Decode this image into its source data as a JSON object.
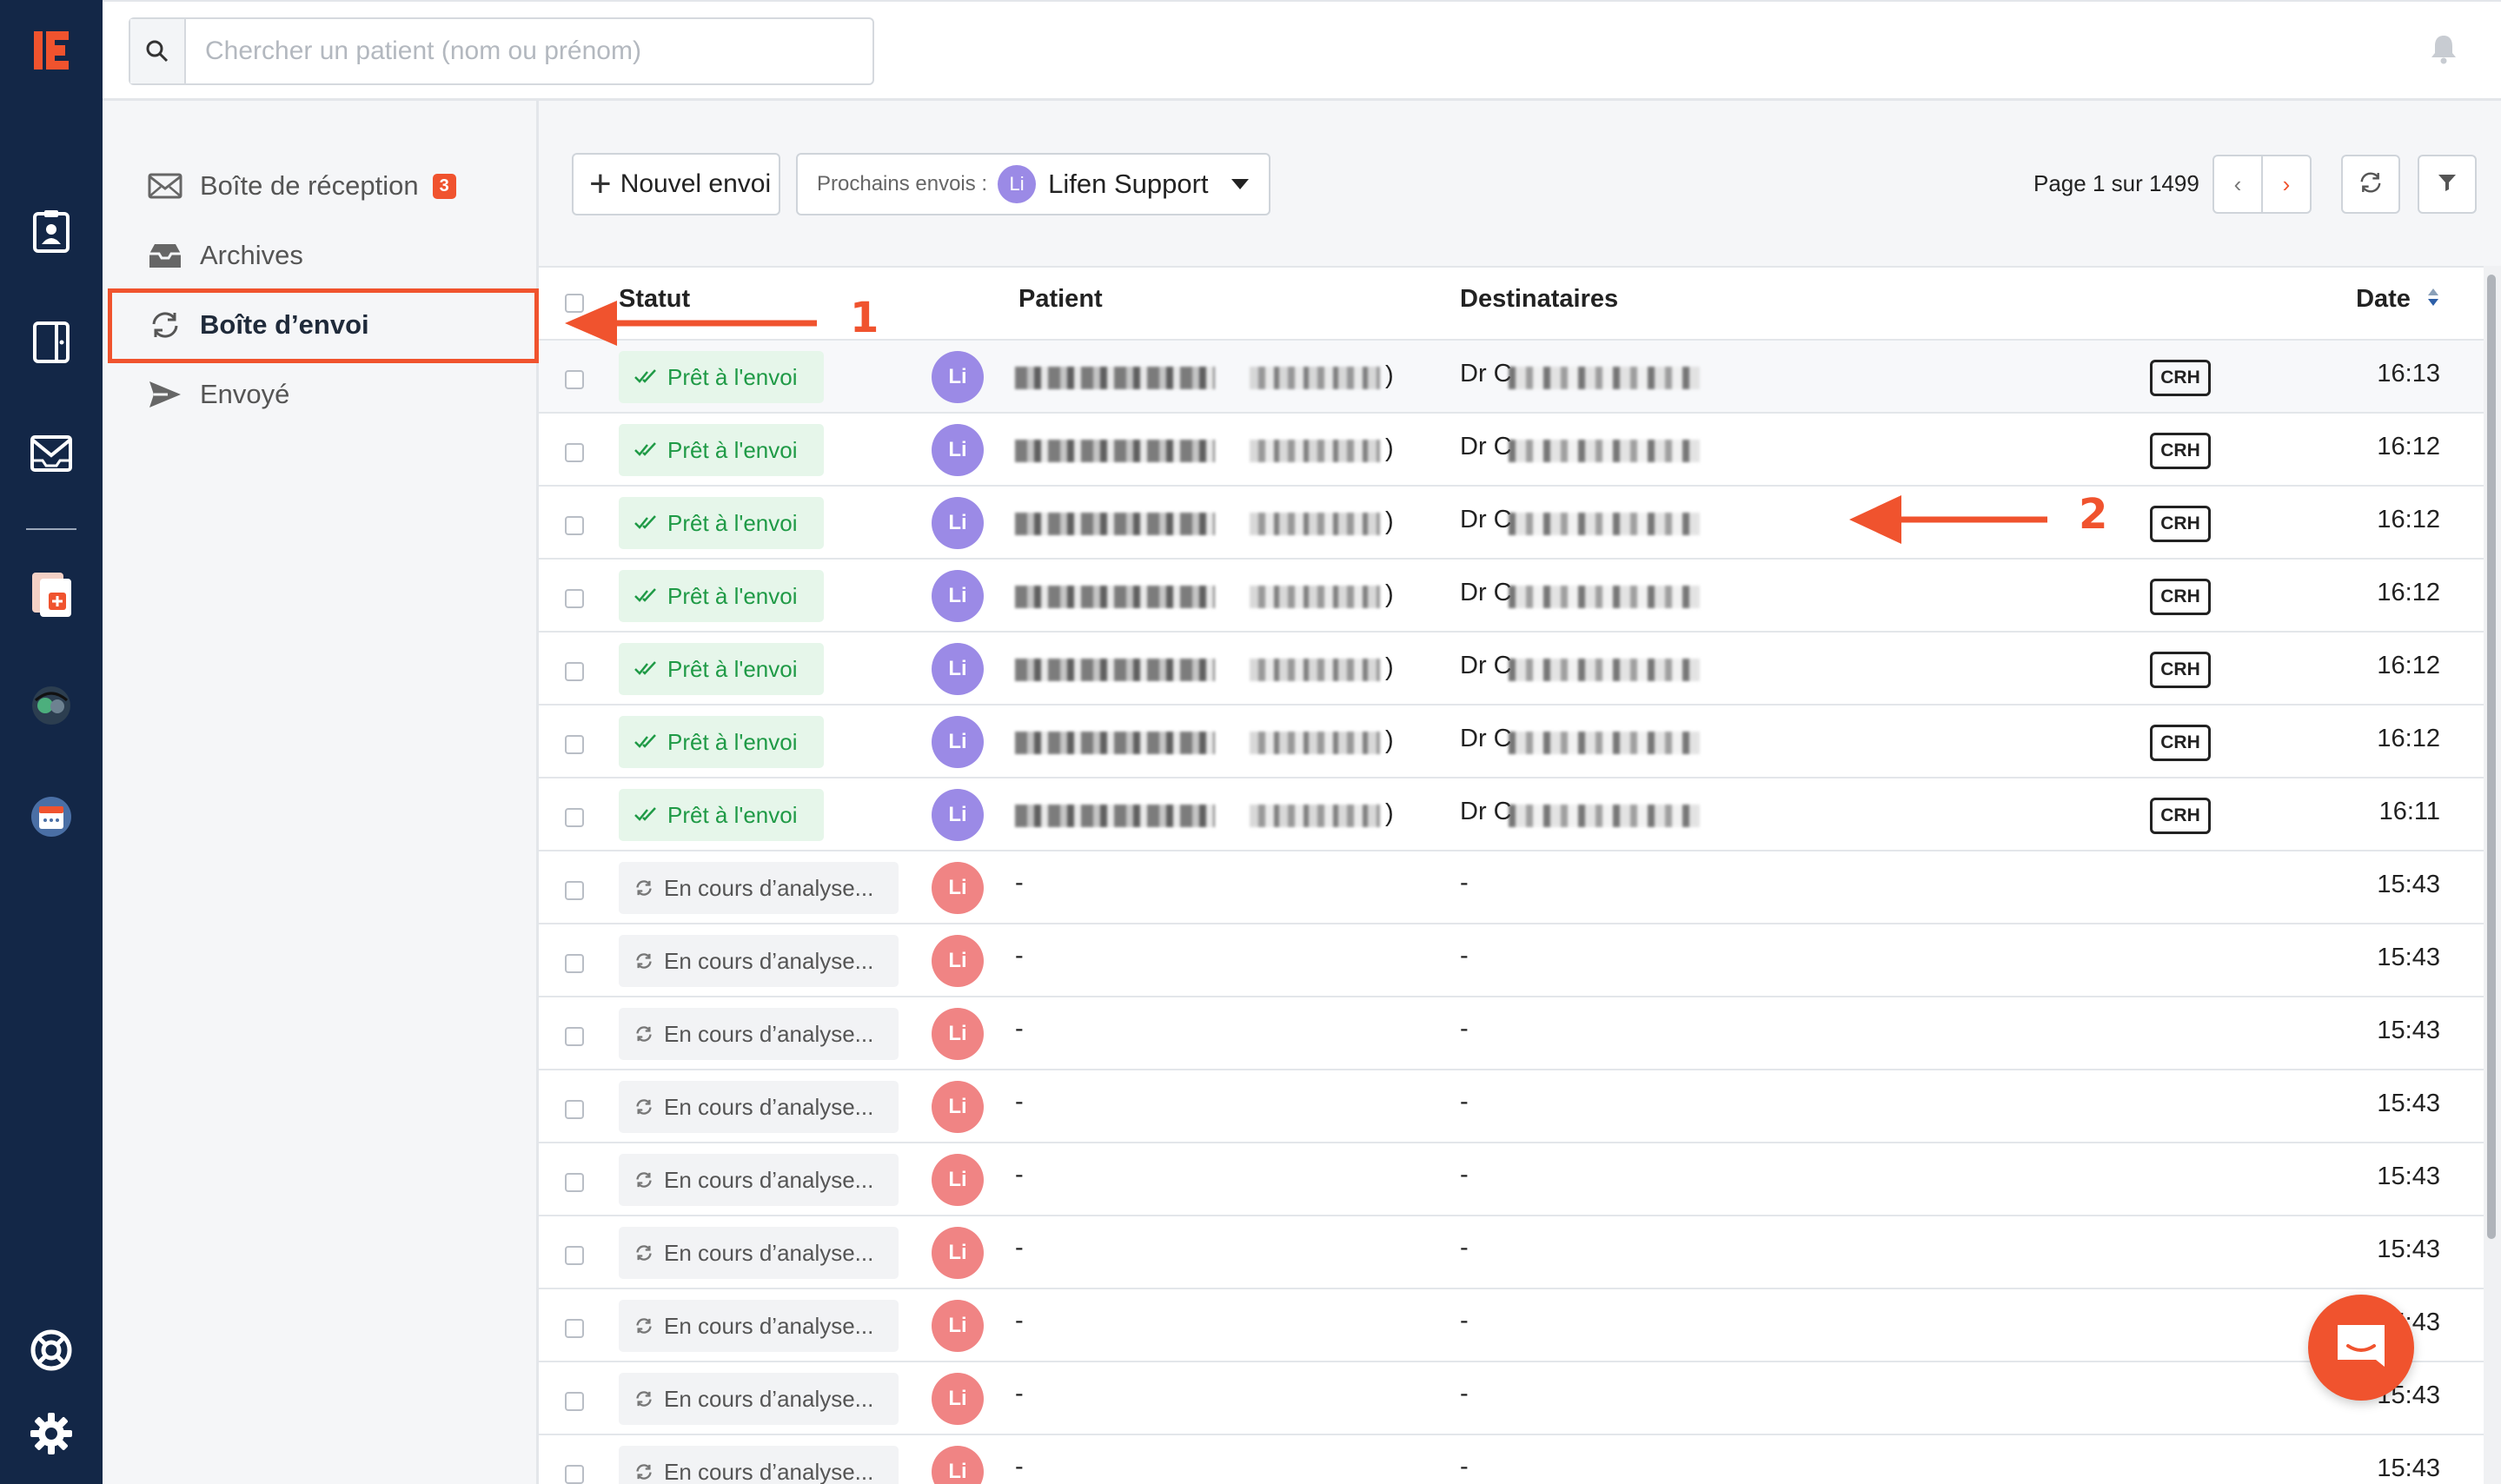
{
  "search": {
    "placeholder": "Chercher un patient (nom ou prénom)"
  },
  "folders": [
    {
      "label": "Boîte de réception",
      "badge": "3",
      "icon": "inbox-icon"
    },
    {
      "label": "Archives",
      "icon": "archive-icon"
    },
    {
      "label": "Boîte d’envoi",
      "icon": "sync-icon",
      "active": true
    },
    {
      "label": "Envoyé",
      "icon": "send-icon"
    }
  ],
  "toolbar": {
    "new_send": "Nouvel envoi",
    "next_sends_label": "Prochains envois :",
    "next_sends_avatar": "Li",
    "next_sends_value": "Lifen Support",
    "page_info": "Page 1 sur 1499",
    "prev": "‹",
    "next": "›"
  },
  "table": {
    "headers": {
      "status": "Statut",
      "patient": "Patient",
      "recipients": "Destinataires",
      "date": "Date"
    },
    "rows": [
      {
        "status": "Prêt à l'envoi",
        "kind": "ready",
        "avatar": "Li",
        "patient_suffix": ")",
        "recipient_prefix": "Dr C",
        "doc": "CRH",
        "time": "16:13"
      },
      {
        "status": "Prêt à l'envoi",
        "kind": "ready",
        "avatar": "Li",
        "patient_suffix": ")",
        "recipient_prefix": "Dr C",
        "doc": "CRH",
        "time": "16:12"
      },
      {
        "status": "Prêt à l'envoi",
        "kind": "ready",
        "avatar": "Li",
        "patient_suffix": ")",
        "recipient_prefix": "Dr C",
        "doc": "CRH",
        "time": "16:12"
      },
      {
        "status": "Prêt à l'envoi",
        "kind": "ready",
        "avatar": "Li",
        "patient_suffix": ")",
        "recipient_prefix": "Dr C",
        "doc": "CRH",
        "time": "16:12"
      },
      {
        "status": "Prêt à l'envoi",
        "kind": "ready",
        "avatar": "Li",
        "patient_suffix": ")",
        "recipient_prefix": "Dr C",
        "doc": "CRH",
        "time": "16:12"
      },
      {
        "status": "Prêt à l'envoi",
        "kind": "ready",
        "avatar": "Li",
        "patient_suffix": ")",
        "recipient_prefix": "Dr C",
        "doc": "CRH",
        "time": "16:12"
      },
      {
        "status": "Prêt à l'envoi",
        "kind": "ready",
        "avatar": "Li",
        "patient_suffix": ")",
        "recipient_prefix": "Dr C",
        "doc": "CRH",
        "time": "16:11"
      },
      {
        "status": "En cours d’analyse...",
        "kind": "analysing",
        "avatar": "Li",
        "patient": "-",
        "recipient": "-",
        "time": "15:43"
      },
      {
        "status": "En cours d’analyse...",
        "kind": "analysing",
        "avatar": "Li",
        "patient": "-",
        "recipient": "-",
        "time": "15:43"
      },
      {
        "status": "En cours d’analyse...",
        "kind": "analysing",
        "avatar": "Li",
        "patient": "-",
        "recipient": "-",
        "time": "15:43"
      },
      {
        "status": "En cours d’analyse...",
        "kind": "analysing",
        "avatar": "Li",
        "patient": "-",
        "recipient": "-",
        "time": "15:43"
      },
      {
        "status": "En cours d’analyse...",
        "kind": "analysing",
        "avatar": "Li",
        "patient": "-",
        "recipient": "-",
        "time": "15:43"
      },
      {
        "status": "En cours d’analyse...",
        "kind": "analysing",
        "avatar": "Li",
        "patient": "-",
        "recipient": "-",
        "time": "15:43"
      },
      {
        "status": "En cours d’analyse...",
        "kind": "analysing",
        "avatar": "Li",
        "patient": "-",
        "recipient": "-",
        "time": "15:43"
      },
      {
        "status": "En cours d’analyse...",
        "kind": "analysing",
        "avatar": "Li",
        "patient": "-",
        "recipient": "-",
        "time": "15:43"
      },
      {
        "status": "En cours d’analyse...",
        "kind": "analysing",
        "avatar": "Li",
        "patient": "-",
        "recipient": "-",
        "time": "15:43"
      }
    ]
  },
  "annotations": {
    "one": "1",
    "two": "2"
  },
  "colors": {
    "accent": "#f0532e",
    "rail": "#132747",
    "ready_bg": "#e6f6ea",
    "ready_text": "#1f9a46",
    "avatar_purple": "#9b8ae6",
    "avatar_red": "#f08484"
  },
  "icons": {
    "rail": [
      "logo-icon",
      "patient-card-icon",
      "tablet-icon",
      "mail-icon",
      "document-add-icon",
      "collaborator-icon",
      "calendar-icon",
      "support-icon",
      "settings-icon"
    ],
    "topbar": [
      "search-icon",
      "bell-icon"
    ],
    "status": {
      "ready": "double-check-icon",
      "analysing": "spinner-icon"
    },
    "toolbar": [
      "plus-icon",
      "refresh-icon",
      "filter-icon"
    ],
    "chat": "chat-icon"
  }
}
